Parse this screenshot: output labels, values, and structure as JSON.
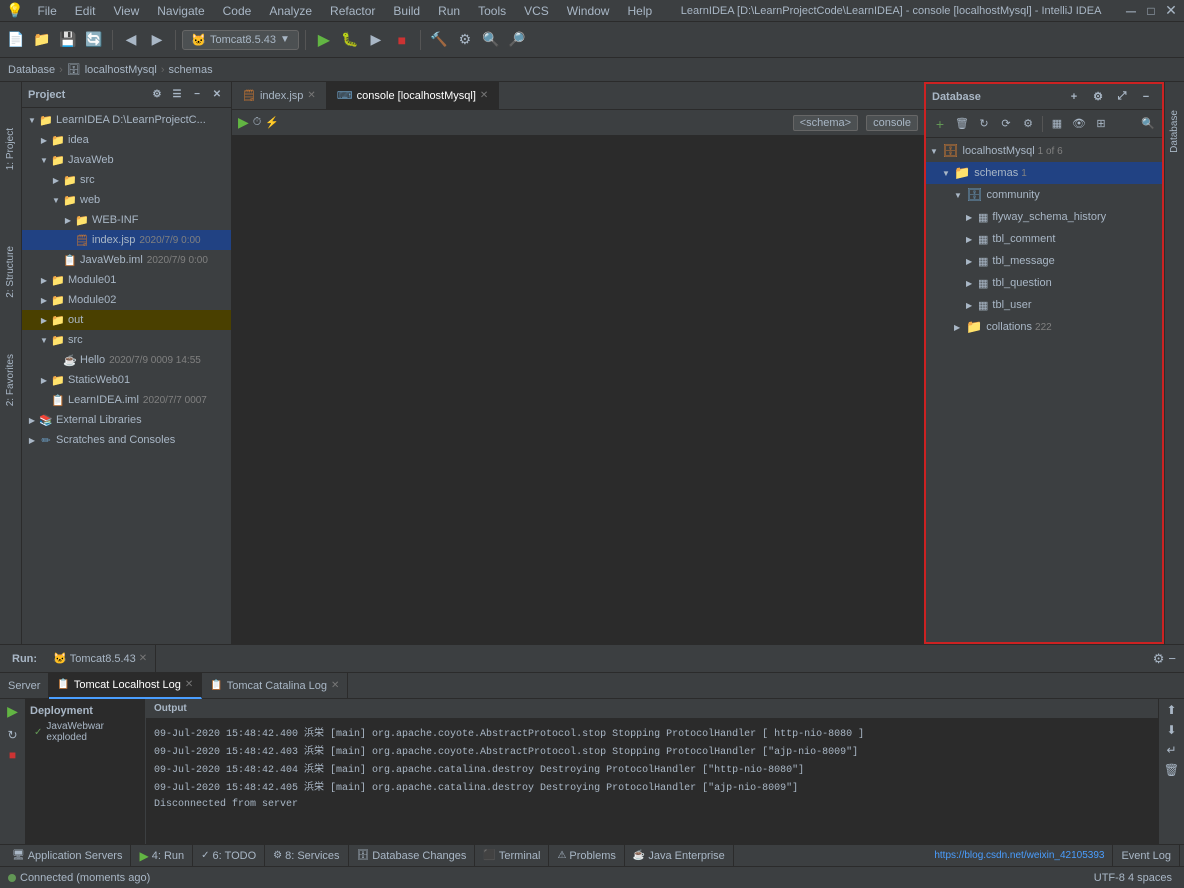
{
  "app": {
    "title": "LearnIDEA [D:\\LearnProjectCode\\LearnIDEA] - console [localhostMysql] - IntelliJ IDEA",
    "window_controls": [
      "minimize",
      "maximize",
      "close"
    ]
  },
  "menubar": {
    "items": [
      "File",
      "Edit",
      "View",
      "Navigate",
      "Code",
      "Analyze",
      "Refactor",
      "Build",
      "Run",
      "Tools",
      "VCS",
      "Window",
      "Help"
    ]
  },
  "toolbar": {
    "tomcat_label": "Tomcat8.5.43"
  },
  "breadcrumb": {
    "items": [
      "Database",
      "localhostMysql",
      "schemas"
    ]
  },
  "project_panel": {
    "title": "Project",
    "tree": [
      {
        "label": "LearnIDEA D:\\LearnProjectC...",
        "level": 0,
        "type": "root",
        "expanded": true
      },
      {
        "label": "idea",
        "level": 1,
        "type": "folder"
      },
      {
        "label": "JavaWeb",
        "level": 1,
        "type": "folder",
        "expanded": true
      },
      {
        "label": "src",
        "level": 2,
        "type": "folder"
      },
      {
        "label": "web",
        "level": 2,
        "type": "folder",
        "expanded": true
      },
      {
        "label": "WEB-INF",
        "level": 3,
        "type": "folder"
      },
      {
        "label": "index.jsp",
        "level": 3,
        "type": "file",
        "extra": "2020/7/9 0:00"
      },
      {
        "label": "JavaWeb.iml",
        "level": 2,
        "type": "iml",
        "extra": "2020/7/9 0:00"
      },
      {
        "label": "Module01",
        "level": 1,
        "type": "folder"
      },
      {
        "label": "Module02",
        "level": 1,
        "type": "folder"
      },
      {
        "label": "out",
        "level": 1,
        "type": "folder"
      },
      {
        "label": "src",
        "level": 1,
        "type": "folder",
        "expanded": true
      },
      {
        "label": "Hello",
        "level": 2,
        "type": "java",
        "extra": "2020/7/9 0009 14:55"
      },
      {
        "label": "StaticWeb01",
        "level": 1,
        "type": "folder"
      },
      {
        "label": "LearnIDEA.iml",
        "level": 1,
        "type": "iml",
        "extra": "2020/7/7 0007"
      },
      {
        "label": "External Libraries",
        "level": 0,
        "type": "ext"
      },
      {
        "label": "Scratches and Consoles",
        "level": 0,
        "type": "scratches"
      }
    ]
  },
  "editor": {
    "tabs": [
      {
        "label": "index.jsp",
        "active": false
      },
      {
        "label": "console [localhostMysql]",
        "active": true
      }
    ],
    "toolbar": {
      "schema": "<schema>",
      "console": "console"
    }
  },
  "database_panel": {
    "title": "Database",
    "tree": [
      {
        "label": "localhostMysql",
        "badge": "1 of 6",
        "level": 0,
        "expanded": true
      },
      {
        "label": "schemas",
        "badge": "1",
        "level": 1,
        "expanded": true,
        "selected": true
      },
      {
        "label": "community",
        "level": 2,
        "expanded": true
      },
      {
        "label": "flyway_schema_history",
        "level": 3
      },
      {
        "label": "tbl_comment",
        "level": 3
      },
      {
        "label": "tbl_message",
        "level": 3
      },
      {
        "label": "tbl_question",
        "level": 3
      },
      {
        "label": "tbl_user",
        "level": 3
      },
      {
        "label": "collations",
        "badge": "222",
        "level": 2
      }
    ]
  },
  "run_panel": {
    "title": "Run:",
    "tomcat_tab": "Tomcat8.5.43",
    "tabs": [
      {
        "label": "Server",
        "active": false
      },
      {
        "label": "Tomcat Localhost Log",
        "active": true
      },
      {
        "label": "Tomcat Catalina Log",
        "active": false
      }
    ],
    "sections": {
      "deployment": "Deployment",
      "deployment_item": "JavaWebwar exploded"
    },
    "output_lines": [
      "09-Jul-2020 15:48:42.400 浜栄 [main] org.apache.coyote.AbstractProtocol.stop Stopping ProtocolHandler [ http-nio-8080 ]",
      "09-Jul-2020 15:48:42.403 浜栄 [main] org.apache.coyote.AbstractProtocol.stop Stopping ProtocolHandler [\"ajp-nio-8009\"]",
      "09-Jul-2020 15:48:42.404 浜栄 [main] org.apache.catalina.destroy Destroying ProtocolHandler [\"http-nio-8080\"]",
      "09-Jul-2020 15:48:42.405 浜栄 [main] org.apache.catalina.destroy Destroying ProtocolHandler [\"ajp-nio-8009\"]",
      "Disconnected from server"
    ]
  },
  "statusbar": {
    "left": "Connected (moments ago)",
    "items": [
      "Application Servers",
      "4: Run",
      "6: TODO",
      "8: Services",
      "Database Changes",
      "Terminal",
      "Problems",
      "Java Enterprise"
    ],
    "right": {
      "url": "https://blog.csdn.net/weixin_42105393",
      "event_log": "Event Log",
      "position": "UTF-8  4 spaces"
    }
  },
  "sidebar_right": {
    "tabs": [
      "Database"
    ]
  }
}
